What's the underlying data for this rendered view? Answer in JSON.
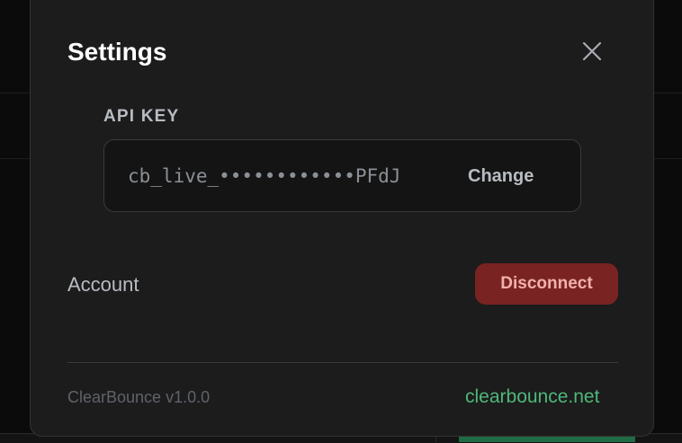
{
  "modal": {
    "title": "Settings",
    "close_icon": "close-icon"
  },
  "api_key": {
    "label": "API KEY",
    "value": "cb_live_••••••••••••PFdJ",
    "change_label": "Change"
  },
  "account": {
    "label": "Account",
    "disconnect_label": "Disconnect"
  },
  "footer": {
    "version": "ClearBounce v1.0.0",
    "link": "clearbounce.net"
  },
  "colors": {
    "modal_bg": "#1c1c1c",
    "danger_bg": "#7a2323",
    "danger_text": "#f2b0ac",
    "link": "#4fb77a"
  }
}
